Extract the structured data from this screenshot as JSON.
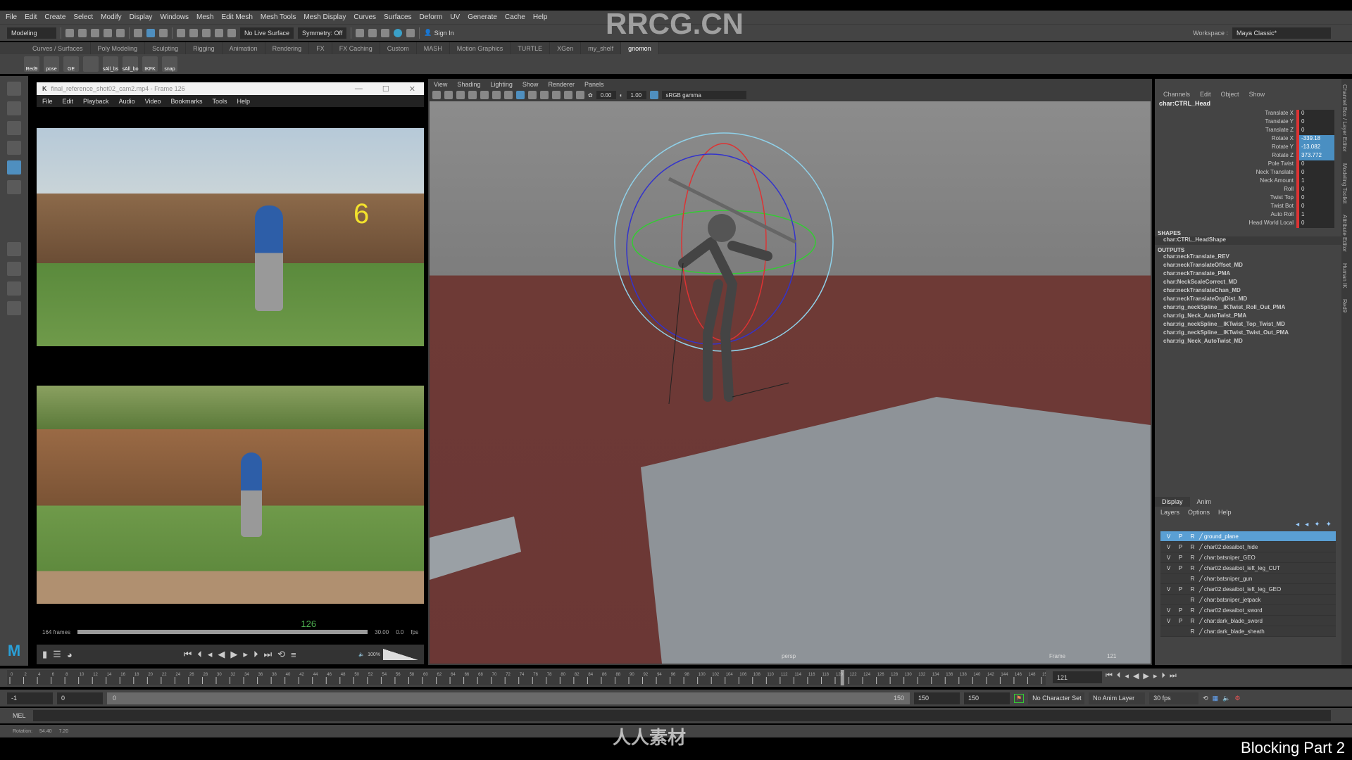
{
  "menubar": [
    "File",
    "Edit",
    "Create",
    "Select",
    "Modify",
    "Display",
    "Windows",
    "Mesh",
    "Edit Mesh",
    "Mesh Tools",
    "Mesh Display",
    "Curves",
    "Surfaces",
    "Deform",
    "UV",
    "Generate",
    "Cache",
    "Help"
  ],
  "status": {
    "mode": "Modeling",
    "live_surface": "No Live Surface",
    "symmetry": "Symmetry: Off",
    "sign_in": "Sign In",
    "workspace_label": "Workspace :",
    "workspace": "Maya Classic*"
  },
  "shelf_tabs": [
    "Curves / Surfaces",
    "Poly Modeling",
    "Sculpting",
    "Rigging",
    "Animation",
    "Rendering",
    "FX",
    "FX Caching",
    "Custom",
    "MASH",
    "Motion Graphics",
    "TURTLE",
    "XGen",
    "my_shelf",
    "gnomon"
  ],
  "shelf_active": "gnomon",
  "shelf_buttons": [
    "Red9",
    "pose",
    "GE",
    "",
    "sAll_bs",
    "sAll_bo",
    "IKFK",
    "snap"
  ],
  "player": {
    "title": "final_reference_shot02_cam2.mp4 - Frame 126",
    "menu": [
      "File",
      "Edit",
      "Playback",
      "Audio",
      "Video",
      "Bookmarks",
      "Tools",
      "Help"
    ],
    "overlay": "6",
    "frames": "164 frames",
    "current_frame": "126",
    "fps": "30.00",
    "speed": "0.0",
    "fps_unit": "fps",
    "volume": "100%",
    "progress": 0.77
  },
  "viewport": {
    "menu": [
      "View",
      "Shading",
      "Lighting",
      "Show",
      "Renderer",
      "Panels"
    ],
    "exposure": "0.00",
    "gamma": "1.00",
    "colorspace": "sRGB gamma",
    "camera": "persp",
    "frame_label": "Frame",
    "frame": "121"
  },
  "channel_box": {
    "menu": [
      "Channels",
      "Edit",
      "Object",
      "Show"
    ],
    "node": "char:CTRL_Head",
    "channels": [
      {
        "name": "Translate X",
        "value": "0"
      },
      {
        "name": "Translate Y",
        "value": "0"
      },
      {
        "name": "Translate Z",
        "value": "0"
      },
      {
        "name": "Rotate X",
        "value": "-339.18",
        "sel": true
      },
      {
        "name": "Rotate Y",
        "value": "-13.082",
        "sel": true
      },
      {
        "name": "Rotate Z",
        "value": "373.772",
        "sel": true
      },
      {
        "name": "Pole Twist",
        "value": "0"
      },
      {
        "name": "Neck Translate",
        "value": "0"
      },
      {
        "name": "Neck Amount",
        "value": "1"
      },
      {
        "name": "Roll",
        "value": "0"
      },
      {
        "name": "Twist Top",
        "value": "0"
      },
      {
        "name": "Twist Bot",
        "value": "0"
      },
      {
        "name": "Auto Roll",
        "value": "1"
      },
      {
        "name": "Head World Local",
        "value": "0"
      }
    ],
    "shapes_label": "SHAPES",
    "shape": "char:CTRL_HeadShape",
    "outputs_label": "OUTPUTS",
    "outputs": [
      "char:neckTranslate_REV",
      "char:neckTranslateOffset_MD",
      "char:neckTranslate_PMA",
      "char:NeckScaleCorrect_MD",
      "char:neckTranslateChan_MD",
      "char:neckTranslateOrgDist_MD",
      "char:rig_neckSpline__IKTwist_Roll_Out_PMA",
      "char:rig_Neck_AutoTwist_PMA",
      "char:rig_neckSpline__IKTwist_Top_Twist_MD",
      "char:rig_neckSpline__IKTwist_Twist_Out_PMA",
      "char:rig_Neck_AutoTwist_MD"
    ]
  },
  "layer_editor": {
    "tabs": [
      "Display",
      "Anim"
    ],
    "menu": [
      "Layers",
      "Options",
      "Help"
    ],
    "layers": [
      {
        "v": "V",
        "p": "P",
        "r": "R",
        "name": "ground_plane",
        "sel": true
      },
      {
        "v": "V",
        "p": "P",
        "r": "R",
        "name": "char02:desaibot_hide"
      },
      {
        "v": "V",
        "p": "P",
        "r": "R",
        "name": "char:batsniper_GEO"
      },
      {
        "v": "V",
        "p": "P",
        "r": "R",
        "name": "char02:desaibot_left_leg_CUT"
      },
      {
        "v": "",
        "p": "",
        "r": "R",
        "name": "char:batsniper_gun"
      },
      {
        "v": "V",
        "p": "P",
        "r": "R",
        "name": "char02:desaibot_left_leg_GEO"
      },
      {
        "v": "",
        "p": "",
        "r": "R",
        "name": "char:batsniper_jetpack"
      },
      {
        "v": "V",
        "p": "P",
        "r": "R",
        "name": "char02:desaibot_sword"
      },
      {
        "v": "V",
        "p": "P",
        "r": "R",
        "name": "char:dark_blade_sword"
      },
      {
        "v": "",
        "p": "",
        "r": "R",
        "name": "char:dark_blade_sheath"
      }
    ]
  },
  "side_tabs": [
    "Channel Box / Layer Editor",
    "Modeling Toolkit",
    "Attribute Editor",
    "Human IK",
    "Red9"
  ],
  "timeline": {
    "start": 0,
    "end": 150,
    "step": 2,
    "current": "121"
  },
  "range": {
    "start_outer": "-1",
    "start": "0",
    "slider_start": "0",
    "slider_end": "150",
    "end": "150",
    "end_outer": "150",
    "character_set": "No Character Set",
    "anim_layer": "No Anim Layer",
    "fps": "30 fps"
  },
  "mel": {
    "label": "MEL"
  },
  "help_line": {
    "label": "Rotation:",
    "x": "54.40",
    "y": "7.20"
  },
  "caption": "Blocking Part 2",
  "watermark": "RRCG.CN",
  "logo": "人人素材"
}
